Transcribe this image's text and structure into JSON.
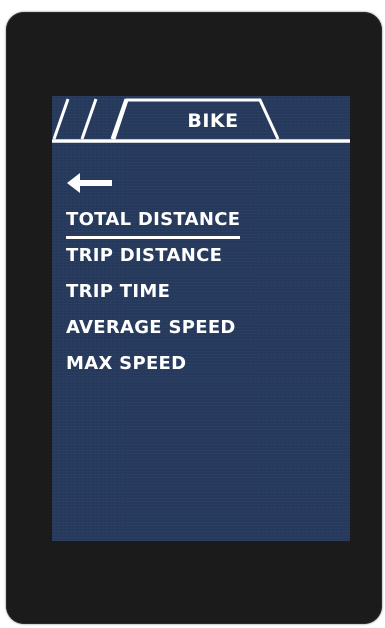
{
  "header": {
    "title": "BIKE"
  },
  "back": {
    "icon": "arrow-left-icon"
  },
  "menu": {
    "items": [
      {
        "label": "TOTAL DISTANCE",
        "selected": true
      },
      {
        "label": "TRIP DISTANCE",
        "selected": false
      },
      {
        "label": "TRIP TIME",
        "selected": false
      },
      {
        "label": "AVERAGE SPEED",
        "selected": false
      },
      {
        "label": "MAX SPEED",
        "selected": false
      }
    ]
  },
  "colors": {
    "screen_bg": "#263a5e",
    "bezel": "#1b1b1b",
    "text": "#ffffff"
  }
}
